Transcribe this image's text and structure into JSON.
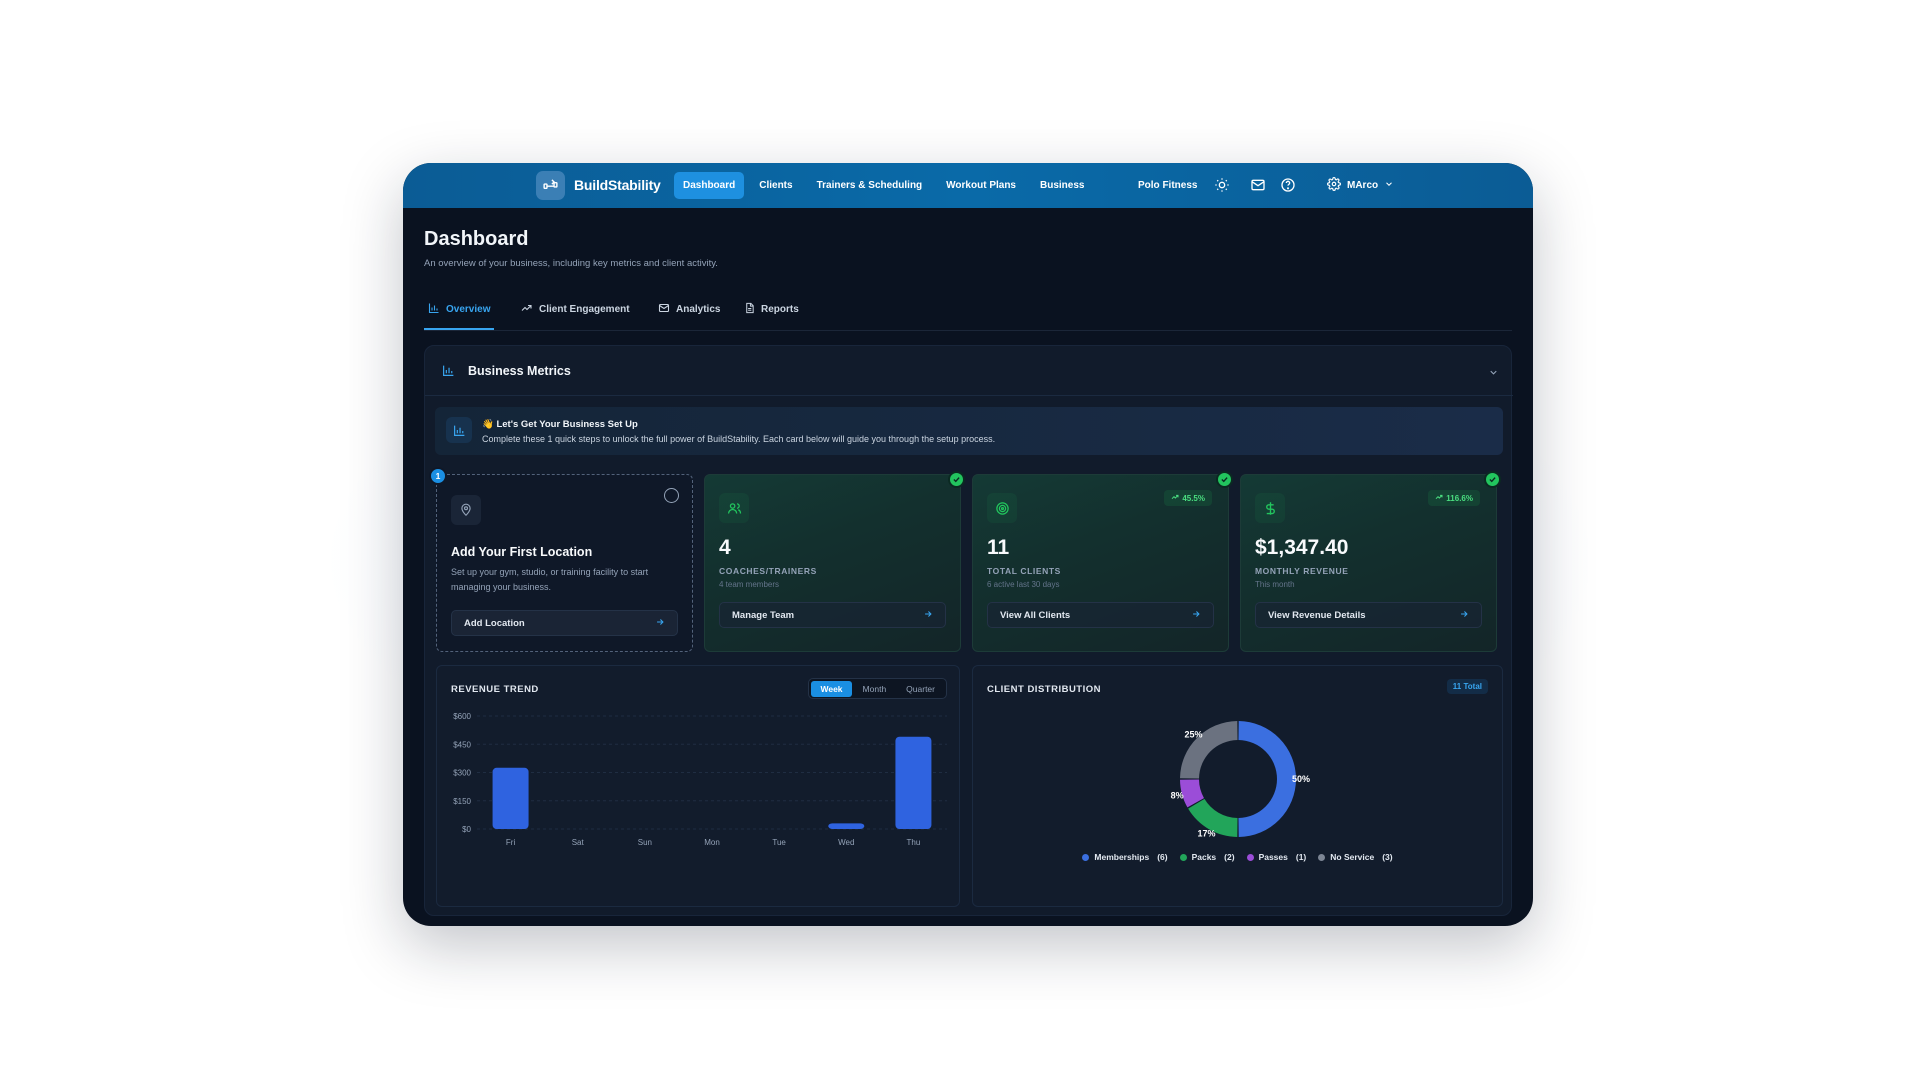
{
  "brand": {
    "name": "BuildStability"
  },
  "nav": {
    "links": [
      "Dashboard",
      "Clients",
      "Trainers & Scheduling",
      "Workout Plans",
      "Business"
    ],
    "active": "Dashboard",
    "org": "Polo Fitness",
    "user": "MArco",
    "icons": [
      "sun-icon",
      "mail-icon",
      "help-icon",
      "settings-icon",
      "chevron-down-icon"
    ]
  },
  "page": {
    "title": "Dashboard",
    "subtitle": "An overview of your business, including key metrics and client activity."
  },
  "tabs": [
    {
      "label": "Overview",
      "icon": "bar-chart-icon",
      "active": true
    },
    {
      "label": "Client Engagement",
      "icon": "trending-up-icon",
      "active": false
    },
    {
      "label": "Analytics",
      "icon": "mail-icon",
      "active": false
    },
    {
      "label": "Reports",
      "icon": "document-icon",
      "active": false
    }
  ],
  "metrics": {
    "title": "Business Metrics",
    "banner": {
      "title": "👋 Let's Get Your Business Set Up",
      "description": "Complete these 1 quick steps to unlock the full power of BuildStability. Each card below will guide you through the setup process."
    },
    "location_card": {
      "step": "1",
      "title": "Add Your First Location",
      "description": "Set up your gym, studio, or training facility to start managing your business.",
      "button": "Add Location"
    },
    "cards": [
      {
        "value": "4",
        "label": "COACHES/TRAINERS",
        "sub": "4 team members",
        "button": "Manage Team",
        "icon": "users-icon",
        "trend": ""
      },
      {
        "value": "11",
        "label": "TOTAL CLIENTS",
        "sub": "6 active last 30 days",
        "button": "View All Clients",
        "icon": "target-icon",
        "trend": "45.5%"
      },
      {
        "value": "$1,347.40",
        "label": "MONTHLY REVENUE",
        "sub": "This month",
        "button": "View Revenue Details",
        "icon": "dollar-icon",
        "trend": "116.6%"
      }
    ]
  },
  "revenue": {
    "title": "REVENUE TREND",
    "periods": [
      "Week",
      "Month",
      "Quarter"
    ],
    "active_period": "Week"
  },
  "distribution": {
    "title": "CLIENT DISTRIBUTION",
    "total": "11 Total",
    "legend": [
      {
        "label": "Memberships",
        "count": "(6)",
        "color": "#3b6fe0"
      },
      {
        "label": "Packs",
        "count": "(2)",
        "color": "#22a55a"
      },
      {
        "label": "Passes",
        "count": "(1)",
        "color": "#9b4dd8"
      },
      {
        "label": "No Service",
        "count": "(3)",
        "color": "#7c8594"
      }
    ]
  },
  "chart_data": [
    {
      "type": "bar",
      "title": "REVENUE TREND",
      "categories": [
        "Fri",
        "Sat",
        "Sun",
        "Mon",
        "Tue",
        "Wed",
        "Thu"
      ],
      "values": [
        325,
        0,
        0,
        0,
        0,
        30,
        490
      ],
      "ylim": [
        0,
        600
      ],
      "yticks": [
        "$0",
        "$150",
        "$300",
        "$450",
        "$600"
      ],
      "ytick_values": [
        0,
        150,
        300,
        450,
        600
      ],
      "grid": true,
      "color": "#2f63e0"
    },
    {
      "type": "pie",
      "title": "CLIENT DISTRIBUTION",
      "categories": [
        "Memberships",
        "Packs",
        "Passes",
        "No Service"
      ],
      "values": [
        6,
        2,
        1,
        3
      ],
      "labels": [
        "50%",
        "17%",
        "8%",
        "25%"
      ],
      "colors": [
        "#3b6fe0",
        "#22a55a",
        "#9b4dd8",
        "#6b7280"
      ]
    }
  ]
}
